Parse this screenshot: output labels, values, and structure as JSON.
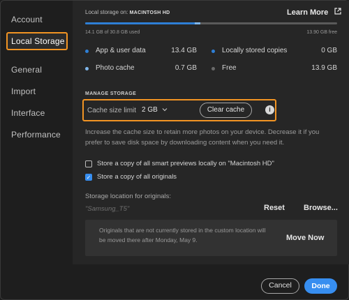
{
  "sidebar": {
    "items": [
      {
        "label": "Account"
      },
      {
        "label": "Local Storage",
        "active": true
      },
      {
        "label": "General"
      },
      {
        "label": "Import"
      },
      {
        "label": "Interface"
      },
      {
        "label": "Performance"
      }
    ]
  },
  "storage": {
    "heading_prefix": "Local storage on:",
    "drive_name": "MACINTOSH HD",
    "learn_more": "Learn More",
    "used_text": "14.1 GB of 30.8 GB used",
    "free_text": "13.90 GB free",
    "used_fraction": 0.458,
    "photo_cache_fraction": 0.023,
    "stats": [
      {
        "label": "App & user data",
        "value": "13.4 GB",
        "dot_color": "#2e7fd6"
      },
      {
        "label": "Locally stored copies",
        "value": "0 GB",
        "dot_color": "#2e7fd6"
      },
      {
        "label": "Photo cache",
        "value": "0.7 GB",
        "dot_color": "#7fb6ea"
      },
      {
        "label": "Free",
        "value": "13.9 GB",
        "dot_color": "#6a6a6a"
      }
    ]
  },
  "manage": {
    "section_title": "MANAGE STORAGE",
    "cache_label": "Cache size limit",
    "cache_value": "2 GB",
    "clear_cache": "Clear cache",
    "description": "Increase the cache size to retain more photos on your device. Decrease it if you prefer to save disk space by downloading content when you need it.",
    "checkboxes": [
      {
        "label": "Store a copy of all smart previews locally on \"Macintosh HD\"",
        "checked": false
      },
      {
        "label": "Store a copy of all originals",
        "checked": true
      }
    ],
    "location_label": "Storage location for originals:",
    "location_path": "\"Samsung_T5\"",
    "reset": "Reset",
    "browse": "Browse...",
    "notice": "Originals that are not currently stored in the custom location will be moved there after Monday, May 9.",
    "move_now": "Move Now"
  },
  "footer": {
    "cancel": "Cancel",
    "done": "Done"
  },
  "colors": {
    "accent": "#378ef0",
    "highlight": "#f29423",
    "bar_blue": "#2e7fd6",
    "bar_light": "#7fb6ea"
  }
}
